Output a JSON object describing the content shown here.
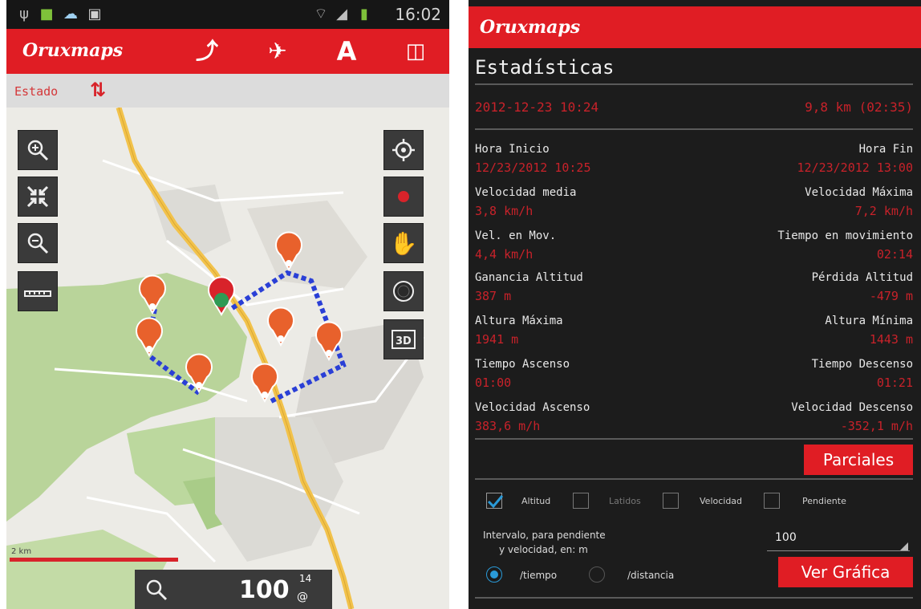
{
  "left": {
    "status_bar": {
      "time": "16:02"
    },
    "app": {
      "logo_part1": "Oruxmaps"
    },
    "estado": {
      "label": "Estado"
    },
    "map": {
      "scale_label": "2 km",
      "zoom_value": "100",
      "zoom_sup": "14",
      "zoom_sub": "@"
    },
    "icons": {
      "zoom_in": "zoom-in-icon",
      "fit": "fit-screen-icon",
      "zoom_out": "zoom-out-icon",
      "ruler": "ruler-icon",
      "locate": "crosshair-icon",
      "record": "record-icon",
      "hand": "hand-icon",
      "compass": "compass-icon",
      "view3d": "3d-view-icon",
      "search": "search-icon"
    }
  },
  "right": {
    "app": {
      "logo": "Oruxmaps"
    },
    "title": "Estadísticas",
    "track_date": "2012-12-23 10:24",
    "track_summary": "9,8 km (02:35)",
    "stats": [
      {
        "l_label": "Hora Inicio",
        "l_value": "12/23/2012 10:25",
        "r_label": "Hora Fin",
        "r_value": "12/23/2012 13:00"
      },
      {
        "l_label": "Velocidad media",
        "l_value": "3,8 km/h",
        "r_label": "Velocidad Máxima",
        "r_value": "7,2 km/h"
      },
      {
        "l_label": "Vel. en Mov.",
        "l_value": "4,4 km/h",
        "r_label": "Tiempo en movimiento",
        "r_value": "02:14"
      },
      {
        "l_label": "Ganancia Altitud",
        "l_value": "387 m",
        "r_label": "Pérdida Altitud",
        "r_value": "-479 m"
      },
      {
        "l_label": "Altura Máxima",
        "l_value": "1941 m",
        "r_label": "Altura Mínima",
        "r_value": "1443 m"
      },
      {
        "l_label": "Tiempo Ascenso",
        "l_value": "01:00",
        "r_label": "Tiempo Descenso",
        "r_value": "01:21"
      },
      {
        "l_label": "Velocidad Ascenso",
        "l_value": "383,6 m/h",
        "r_label": "Velocidad Descenso",
        "r_value": "-352,1 m/h"
      }
    ],
    "parciales_button": "Parciales",
    "checkboxes": [
      {
        "label": "Altitud",
        "checked": true
      },
      {
        "label": "Latidos",
        "checked": false
      },
      {
        "label": "Velocidad",
        "checked": false
      },
      {
        "label": "Pendiente",
        "checked": false
      }
    ],
    "interval_label_line1": "Intervalo, para pendiente",
    "interval_label_line2": "y velocidad, en: m",
    "interval_value": "100",
    "radio_tiempo": "/tiempo",
    "radio_distancia": "/distancia",
    "ver_grafica_button": "Ver Gráfica"
  }
}
